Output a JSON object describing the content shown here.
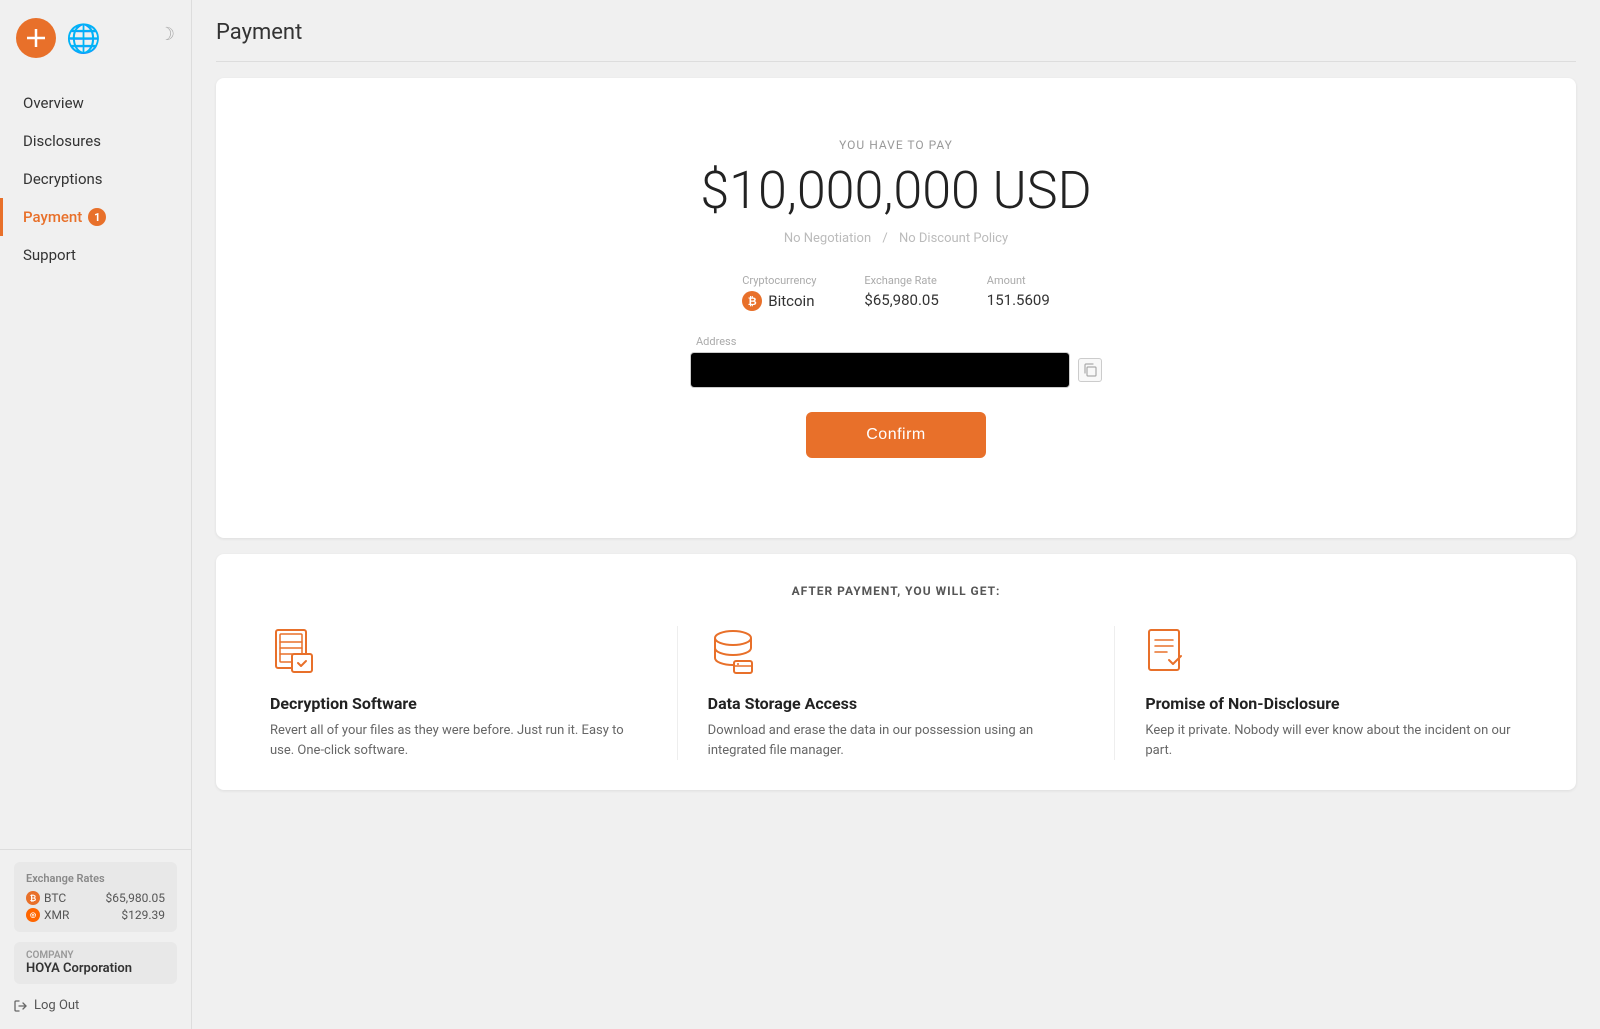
{
  "sidebar": {
    "logo_symbol": "+",
    "theme_icon": "☽",
    "nav_items": [
      {
        "id": "overview",
        "label": "Overview",
        "active": false,
        "badge": null
      },
      {
        "id": "disclosures",
        "label": "Disclosures",
        "active": false,
        "badge": null
      },
      {
        "id": "decryptions",
        "label": "Decryptions",
        "active": false,
        "badge": null
      },
      {
        "id": "payment",
        "label": "Payment",
        "active": true,
        "badge": "1"
      },
      {
        "id": "support",
        "label": "Support",
        "active": false,
        "badge": null
      }
    ],
    "exchange_rates": {
      "title": "Exchange Rates",
      "items": [
        {
          "coin": "BTC",
          "rate": "$65,980.05"
        },
        {
          "coin": "XMR",
          "rate": "$129.39"
        }
      ]
    },
    "company": {
      "label": "Company",
      "name": "HOYA Corporation"
    },
    "logout_label": "Log Out"
  },
  "page": {
    "title": "Payment"
  },
  "payment": {
    "pay_label": "YOU HAVE TO PAY",
    "amount": "$10,000,000 USD",
    "policy_no_negotiation": "No Negotiation",
    "policy_separator": "/",
    "policy_no_discount": "No Discount Policy",
    "crypto": {
      "currency_label": "Cryptocurrency",
      "currency_icon": "₿",
      "currency_name": "Bitcoin",
      "rate_label": "Exchange Rate",
      "rate_value": "$65,980.05",
      "amount_label": "Amount",
      "amount_value": "151.5609"
    },
    "address_label": "Address",
    "address_value": "",
    "copy_icon": "⧉",
    "confirm_button": "Confirm"
  },
  "after_payment": {
    "title": "AFTER PAYMENT, YOU WILL GET:",
    "benefits": [
      {
        "id": "decryption-software",
        "title": "Decryption Software",
        "description": "Revert all of your files as they were before. Just run it. Easy to use. One-click software."
      },
      {
        "id": "data-storage-access",
        "title": "Data Storage Access",
        "description": "Download and erase the data in our possession using an integrated file manager."
      },
      {
        "id": "non-disclosure",
        "title": "Promise of Non-Disclosure",
        "description": "Keep it private. Nobody will ever know about the incident on our part."
      }
    ]
  }
}
